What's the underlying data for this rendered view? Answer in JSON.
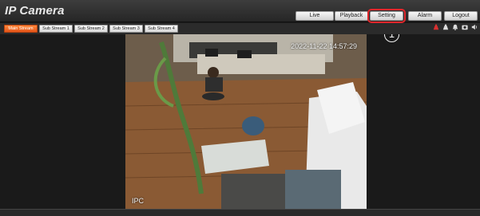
{
  "app": {
    "brand": "IP Camera"
  },
  "nav": {
    "items": [
      "Live",
      "Playback",
      "Setting",
      "Alarm",
      "Logout"
    ],
    "highlighted": "Setting"
  },
  "callout": {
    "label": "1"
  },
  "streams": {
    "tabs": [
      "Main Stream",
      "Sub Stream 1",
      "Sub Stream 2",
      "Sub Stream 3",
      "Sub Stream 4"
    ],
    "active": "Main Stream"
  },
  "toolbar": {
    "icons": [
      "record-icon",
      "alarm-icon",
      "bell-icon",
      "snapshot-icon",
      "audio-icon"
    ]
  },
  "video": {
    "timestamp": "2022-11-22 14:57:29",
    "channel_name": "IPC"
  },
  "colors": {
    "active_tab": "#e4541a",
    "highlight": "#e0262b"
  }
}
